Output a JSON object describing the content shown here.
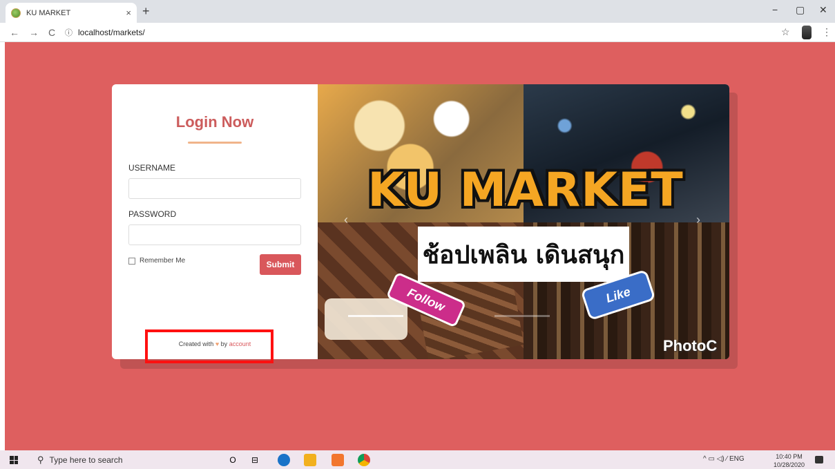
{
  "browser": {
    "tab_title": "KU MARKET",
    "tab_close": "×",
    "new_tab": "+",
    "url": "localhost/markets/",
    "nav_back": "←",
    "nav_forward": "→",
    "nav_reload": "C",
    "info_icon": "ⓘ",
    "star_icon": "☆",
    "menu_icon": "⋮",
    "win_minimize": "−",
    "win_maximize": "▢",
    "win_close": "✕"
  },
  "login": {
    "title": "Login Now",
    "username_label": "USERNAME",
    "username_value": "",
    "password_label": "PASSWORD",
    "password_value": "",
    "remember_label": "Remember Me",
    "submit_label": "Submit",
    "credit_prefix": "Created with",
    "credit_heart": "♥",
    "credit_by": "by",
    "credit_link": "account"
  },
  "collage": {
    "banner_title": "KU MARKET",
    "banner_subtitle": "ช้อปเพลิน เดินสนุก",
    "follow_sticker": "Follow",
    "like_sticker": "Like",
    "watermark": "PhotoC",
    "arrow_left": "‹",
    "arrow_right": "›"
  },
  "taskbar": {
    "search_placeholder": "Type here to search",
    "search_icon": "⚲",
    "cortana_icon": "O",
    "taskview_icon": "⊟",
    "tray": "^  ▭  ◁)  ⁄  ENG",
    "time": "10:40 PM",
    "date": "10/28/2020"
  },
  "colors": {
    "page_bg": "#de5f5f",
    "accent": "#d9575b",
    "highlight_box": "#ff1010"
  }
}
